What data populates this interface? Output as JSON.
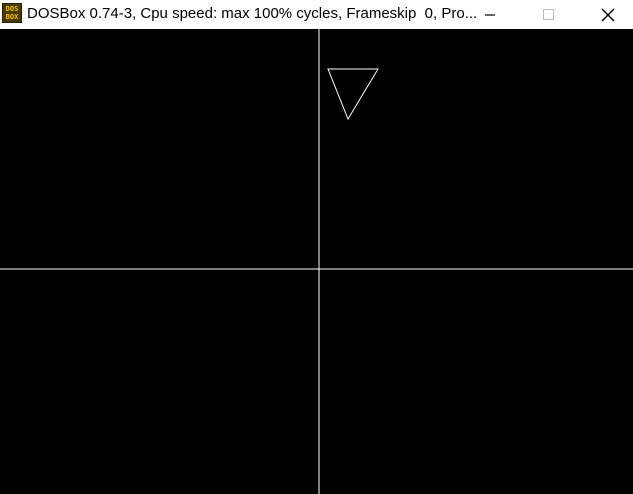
{
  "window": {
    "title": "DOSBox 0.74-3, Cpu speed: max 100% cycles, Frameskip  0, Pro...",
    "icon": {
      "name": "dosbox-icon",
      "line1": "DOS",
      "line2": "BOX"
    },
    "controls": {
      "minimize_icon": "minimize-icon",
      "maximize_icon": "maximize-icon",
      "close_icon": "close-icon"
    }
  },
  "colors": {
    "titlebar_bg": "#ffffff",
    "screen_bg": "#000000",
    "line_color": "#ffffff",
    "icon_text": "#f2c200"
  }
}
